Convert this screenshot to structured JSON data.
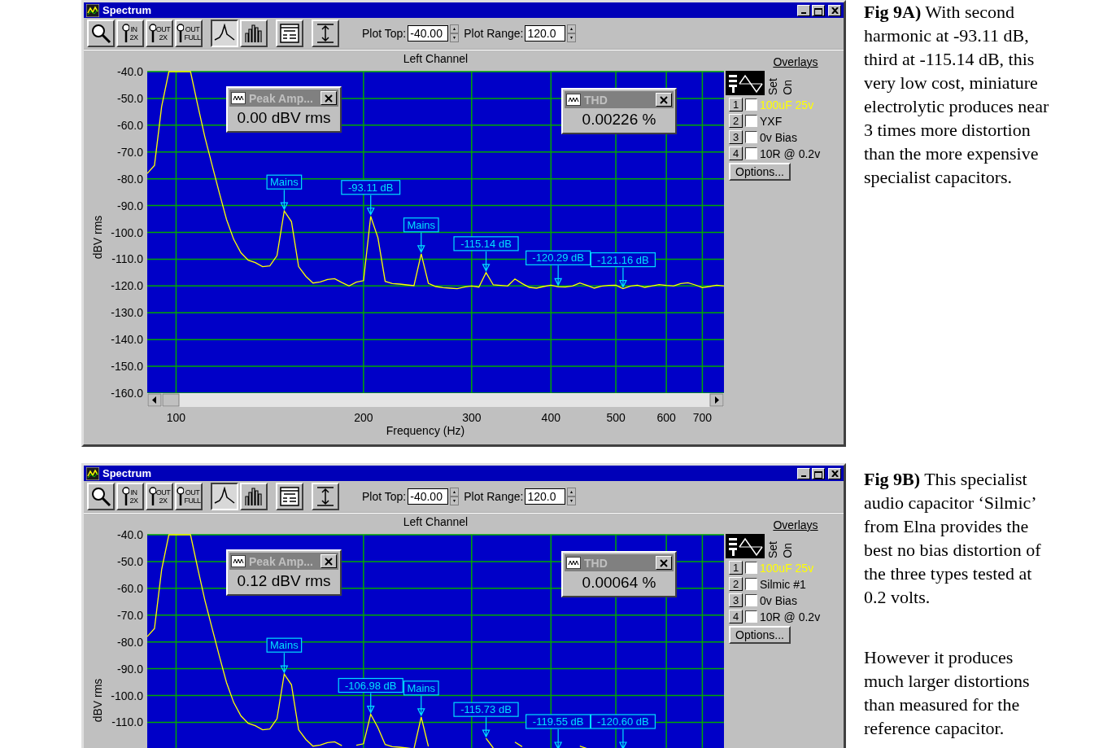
{
  "windows": [
    {
      "title": "Spectrum",
      "toolbar": [
        {
          "kind": "magnifier",
          "selected": false
        },
        {
          "kind": "magnifier-text",
          "top": "IN",
          "bottom": "2X",
          "selected": false
        },
        {
          "kind": "magnifier-text",
          "top": "OUT",
          "bottom": "2X",
          "selected": false
        },
        {
          "kind": "magnifier-text",
          "top": "OUT",
          "bottom": "FULL",
          "selected": false
        },
        {
          "kind": "line-plot",
          "selected": true
        },
        {
          "kind": "bar-plot",
          "selected": false
        },
        {
          "kind": "panel",
          "selected": false
        },
        {
          "kind": "range",
          "selected": false
        }
      ],
      "fields": [
        {
          "label": "Plot Top:",
          "value": "-40.00"
        },
        {
          "label": "Plot Range:",
          "value": "120.0"
        }
      ],
      "chart_data": {
        "type": "line",
        "title": "Left Channel",
        "xlabel": "Frequency (Hz)",
        "ylabel": "dBV rms",
        "grid": true,
        "ylim": [
          -160,
          -40
        ],
        "categories": [
          null,
          null,
          null,
          null,
          "100",
          null,
          null,
          null,
          null,
          null,
          null,
          null,
          null,
          null,
          null,
          null,
          null,
          null,
          null,
          null,
          null,
          null,
          null,
          null,
          null,
          null,
          null,
          null,
          null,
          null,
          "200",
          null,
          null,
          null,
          null,
          null,
          null,
          null,
          null,
          null,
          null,
          null,
          null,
          null,
          null,
          "300",
          null,
          null,
          null,
          null,
          null,
          null,
          null,
          null,
          null,
          null,
          "400",
          null,
          null,
          null,
          null,
          null,
          null,
          null,
          null,
          "500",
          null,
          null,
          null,
          null,
          null,
          null,
          "600",
          null,
          null,
          null,
          null,
          "700",
          null,
          null,
          null
        ],
        "yticks": [
          {
            "value": -40,
            "label": "-40.0"
          },
          {
            "value": -50,
            "label": "-50.0"
          },
          {
            "value": -60,
            "label": "-60.0"
          },
          {
            "value": -70,
            "label": "-70.0"
          },
          {
            "value": -80,
            "label": "-80.0"
          },
          {
            "value": -90,
            "label": "-90.0"
          },
          {
            "value": -100,
            "label": "-100.0"
          },
          {
            "value": -110,
            "label": "-110.0"
          },
          {
            "value": -120,
            "label": "-120.0"
          },
          {
            "value": -130,
            "label": "-130.0"
          },
          {
            "value": -140,
            "label": "-140.0"
          },
          {
            "value": -150,
            "label": "-150.0"
          },
          {
            "value": -160,
            "label": "-160.0"
          }
        ],
        "series": [
          {
            "color": "#ffff00",
            "values": [
              -78,
              -75,
              -53,
              -40,
              -40,
              -40,
              -40,
              -52.4,
              -64.5,
              -75,
              -85.2,
              -95.2,
              -102.6,
              -107.6,
              -110.4,
              -111.3,
              -112.8,
              -112.5,
              -108.7,
              -92,
              -96,
              -112.8,
              -116.4,
              -118.9,
              -118.5,
              -117.6,
              -117.3,
              -118.7,
              -120,
              -118.6,
              -118,
              -94,
              -102,
              -118.3,
              -119.1,
              -119.3,
              -119.6,
              -119.9,
              -108,
              -119,
              -120.2,
              -120.6,
              -120.8,
              -121,
              -120.4,
              -120,
              -120.4,
              -115,
              -119.6,
              -119.8,
              -120,
              -117.4,
              -119.1,
              -120.5,
              -120.8,
              -120.2,
              -119.7,
              -120.3,
              -120.4,
              -120,
              -118.9,
              -119.8,
              -120.8,
              -120.1,
              -119.8,
              -119.7,
              -121,
              -120.1,
              -119.7,
              -120.5,
              -120,
              -119.5,
              -119.8,
              -120,
              -119.1,
              -118.8,
              -119.6,
              -120.6,
              -120.2,
              -119.7,
              -120
            ]
          }
        ],
        "annotations": [
          {
            "y": -92,
            "text": "Mains"
          },
          {
            "y": -94,
            "text": "-93.11 dB"
          },
          {
            "y": -108,
            "text": "Mains"
          },
          {
            "y": -115,
            "text": "-115.14 dB"
          },
          {
            "y": -120.3,
            "text": "-120.29 dB"
          },
          {
            "y": -121,
            "text": "-121.16 dB"
          }
        ]
      },
      "dialogs": [
        {
          "title": "Peak Amp...",
          "value": "0.00 dBV rms"
        },
        {
          "title": "THD",
          "value": "0.00226 %"
        }
      ],
      "overlays": {
        "heading": "Overlays",
        "set_header": "Set",
        "on_header": "On",
        "options_button": "Options...",
        "rows": [
          {
            "number": "1",
            "checked": false,
            "label": "100uF 25v",
            "color": "#ffff00"
          },
          {
            "number": "2",
            "checked": false,
            "label": "YXF",
            "color": "#000000"
          },
          {
            "number": "3",
            "checked": false,
            "label": "0v Bias",
            "color": "#000000"
          },
          {
            "number": "4",
            "checked": false,
            "label": "10R @ 0.2v",
            "color": "#000000"
          }
        ]
      }
    },
    {
      "title": "Spectrum",
      "toolbar": [
        {
          "kind": "magnifier",
          "selected": false
        },
        {
          "kind": "magnifier-text",
          "top": "IN",
          "bottom": "2X",
          "selected": false
        },
        {
          "kind": "magnifier-text",
          "top": "OUT",
          "bottom": "2X",
          "selected": false
        },
        {
          "kind": "magnifier-text",
          "top": "OUT",
          "bottom": "FULL",
          "selected": false
        },
        {
          "kind": "line-plot",
          "selected": true
        },
        {
          "kind": "bar-plot",
          "selected": false
        },
        {
          "kind": "panel",
          "selected": false
        },
        {
          "kind": "range",
          "selected": false
        }
      ],
      "fields": [
        {
          "label": "Plot Top:",
          "value": "-40.00"
        },
        {
          "label": "Plot Range:",
          "value": "120.0"
        }
      ],
      "chart_data": {
        "type": "line",
        "title": "Left Channel",
        "ylabel": "dBV rms",
        "grid": true,
        "ylim": [
          -160,
          -40
        ],
        "categories": [
          null,
          null,
          null,
          null,
          null,
          null,
          null,
          null,
          null,
          null,
          null,
          null,
          null,
          null,
          null,
          null,
          null,
          null,
          null,
          null,
          null,
          null,
          null,
          null,
          null,
          null,
          null,
          null,
          null,
          null,
          null,
          null,
          null,
          null,
          null,
          null,
          null,
          null,
          null,
          null,
          null,
          null,
          null,
          null,
          null,
          null,
          null,
          null,
          null,
          null,
          null,
          null,
          null,
          null,
          null,
          null,
          null,
          null,
          null,
          null,
          null,
          null,
          null,
          null,
          null,
          null,
          null,
          null,
          null,
          null,
          null,
          null,
          null,
          null,
          null,
          null,
          null,
          null,
          null,
          null,
          null
        ],
        "yticks": [
          {
            "value": -40,
            "label": "-40.0"
          },
          {
            "value": -50,
            "label": "-50.0"
          },
          {
            "value": -60,
            "label": "-60.0"
          },
          {
            "value": -70,
            "label": "-70.0"
          },
          {
            "value": -80,
            "label": "-80.0"
          },
          {
            "value": -90,
            "label": "-90.0"
          },
          {
            "value": -100,
            "label": "-100.0"
          },
          {
            "value": -110,
            "label": "-110.0"
          }
        ],
        "series": [
          {
            "color": "#ffff00",
            "values": [
              -78,
              -75,
              -53,
              -40,
              -40,
              -40,
              -40,
              -52.4,
              -64.5,
              -75,
              -85.2,
              -95.2,
              -102.6,
              -107.6,
              -110.4,
              -111.3,
              -112.8,
              -112.5,
              -108.7,
              -92,
              -96,
              -112.8,
              -116.4,
              -118.9,
              -118.5,
              -117.6,
              -117.3,
              -118.7,
              null,
              -118.6,
              -118,
              -107,
              -112,
              -118.3,
              -119.1,
              -119.3,
              -119.6,
              -119.9,
              -108,
              -119,
              null,
              null,
              null,
              null,
              null,
              null,
              null,
              -116,
              -119.6,
              null,
              null,
              -117.4,
              -119.1,
              null,
              null,
              null,
              null,
              null,
              null,
              null,
              -118.9,
              -119.8,
              null,
              null,
              null,
              null,
              null,
              null,
              null,
              null,
              null,
              null,
              null,
              null,
              null,
              null,
              null,
              null,
              null,
              null,
              null
            ]
          }
        ],
        "annotations": [
          {
            "y": -92,
            "text": "Mains"
          },
          {
            "y": -107,
            "text": "-106.98 dB"
          },
          {
            "y": -108,
            "text": "Mains"
          },
          {
            "y": -116,
            "text": "-115.73 dB"
          },
          "-119.55 dB",
          "-120.60 dB"
        ]
      },
      "dialogs": [
        {
          "title": "Peak Amp...",
          "value": "0.12 dBV rms"
        },
        {
          "title": "THD",
          "value": "0.00064 %"
        }
      ],
      "overlays": {
        "heading": "Overlays",
        "set_header": "Set",
        "on_header": "On",
        "options_button": "Options...",
        "rows": [
          {
            "number": "1",
            "checked": false,
            "label": "100uF 25v",
            "color": "#ffff00"
          },
          {
            "number": "2",
            "checked": false,
            "label": "Silmic #1",
            "color": "#000000"
          },
          {
            "number": "3",
            "checked": false,
            "label": "0v Bias",
            "color": "#000000"
          },
          {
            "number": "4",
            "checked": false,
            "label": "10R @ 0.2v",
            "color": "#000000"
          }
        ]
      }
    }
  ],
  "captions": [
    "**Fig 9A)** With second\nharmonic at -93.11 dB,\nthird at -115.14 dB, this\nvery low cost, miniature\nelectrolytic produces near\n3 times more distortion\nthan the more expensive\nspecialist capacitors.",
    "**Fig 9B)** This specialist\naudio capacitor ‘Silmic’\nfrom Elna provides the\nbest no bias distortion of\nthe three types tested at\n0.2 volts.",
    "However it produces\nmuch larger distortions\nthan measured for the\nreference capacitor."
  ]
}
